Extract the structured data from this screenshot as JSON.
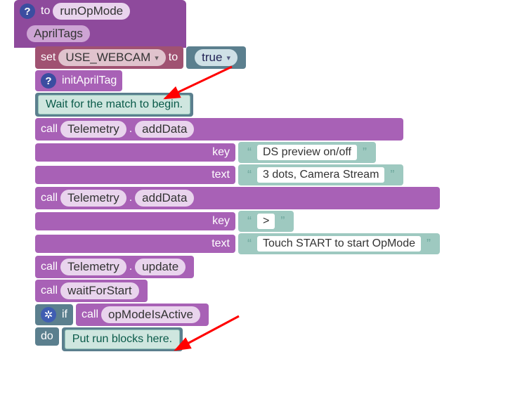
{
  "header": {
    "to_label": "to",
    "func_name": "runOpMode",
    "tag": "AprilTags"
  },
  "set_block": {
    "prefix": "set",
    "var": "USE_WEBCAM",
    "to": "to",
    "value": "true"
  },
  "init_block": {
    "label": "initAprilTag"
  },
  "wait_comment": "Wait for the match to begin.",
  "tel1": {
    "call": "call",
    "obj": "Telemetry",
    "dot": ".",
    "method": "addData",
    "key_label": "key",
    "key_value": "DS preview on/off",
    "text_label": "text",
    "text_value": "3 dots, Camera Stream"
  },
  "tel2": {
    "call": "call",
    "obj": "Telemetry",
    "dot": ".",
    "method": "addData",
    "key_label": "key",
    "key_value": ">",
    "text_label": "text",
    "text_value": "Touch START to start OpMode"
  },
  "tel3": {
    "call": "call",
    "obj": "Telemetry",
    "dot": ".",
    "method": "update"
  },
  "wait_call": {
    "call": "call",
    "method": "waitForStart"
  },
  "if_block": {
    "if": "if",
    "call": "call",
    "cond": "opModeIsActive",
    "do": "do",
    "comment": "Put run blocks here."
  }
}
